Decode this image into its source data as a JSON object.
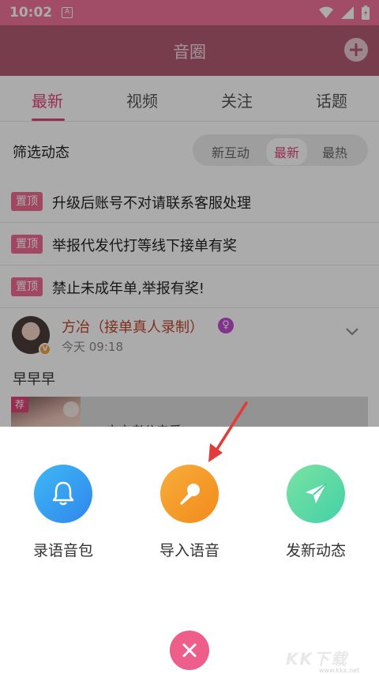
{
  "status_bar": {
    "time": "10:02",
    "app_indicator": "A",
    "icons": [
      "wifi-icon",
      "signal-icon",
      "battery-icon"
    ]
  },
  "app_bar": {
    "title": "音圈",
    "add_icon": "plus-icon"
  },
  "tabs": [
    {
      "label": "最新",
      "active": true
    },
    {
      "label": "视频",
      "active": false
    },
    {
      "label": "关注",
      "active": false
    },
    {
      "label": "话题",
      "active": false
    }
  ],
  "filter": {
    "label": "筛选动态",
    "options": [
      {
        "label": "新互动",
        "active": false
      },
      {
        "label": "最新",
        "active": true
      },
      {
        "label": "最热",
        "active": false
      }
    ]
  },
  "pinned": [
    {
      "badge": "置顶",
      "text": "升级后账号不对请联系客服处理"
    },
    {
      "badge": "置顶",
      "text": "举报代发代打等线下接单有奖"
    },
    {
      "badge": "置顶",
      "text": "禁止未成年单,举报有奖!"
    }
  ],
  "post": {
    "author": "方冶（接单真人录制）",
    "verify_badge": "V",
    "gender_icon": "female-icon",
    "time": "今天 09:18",
    "text": "早早早",
    "media_tag": "荐",
    "media_title": "宁宁老公亲爱"
  },
  "sheet": {
    "actions": [
      {
        "label": "录语音包",
        "icon": "bell-icon",
        "color": "#2f9ef2"
      },
      {
        "label": "导入语音",
        "icon": "microphone-icon",
        "color": "#f49b26"
      },
      {
        "label": "发新动态",
        "icon": "paper-plane-icon",
        "color": "#4fd6a0"
      }
    ],
    "close_icon": "close-icon"
  },
  "watermark": {
    "text": "KK下载",
    "url": "www.kkx.net"
  },
  "colors": {
    "accent": "#e0457a",
    "status_bar": "#f0739b",
    "app_bar": "#b25c74"
  }
}
